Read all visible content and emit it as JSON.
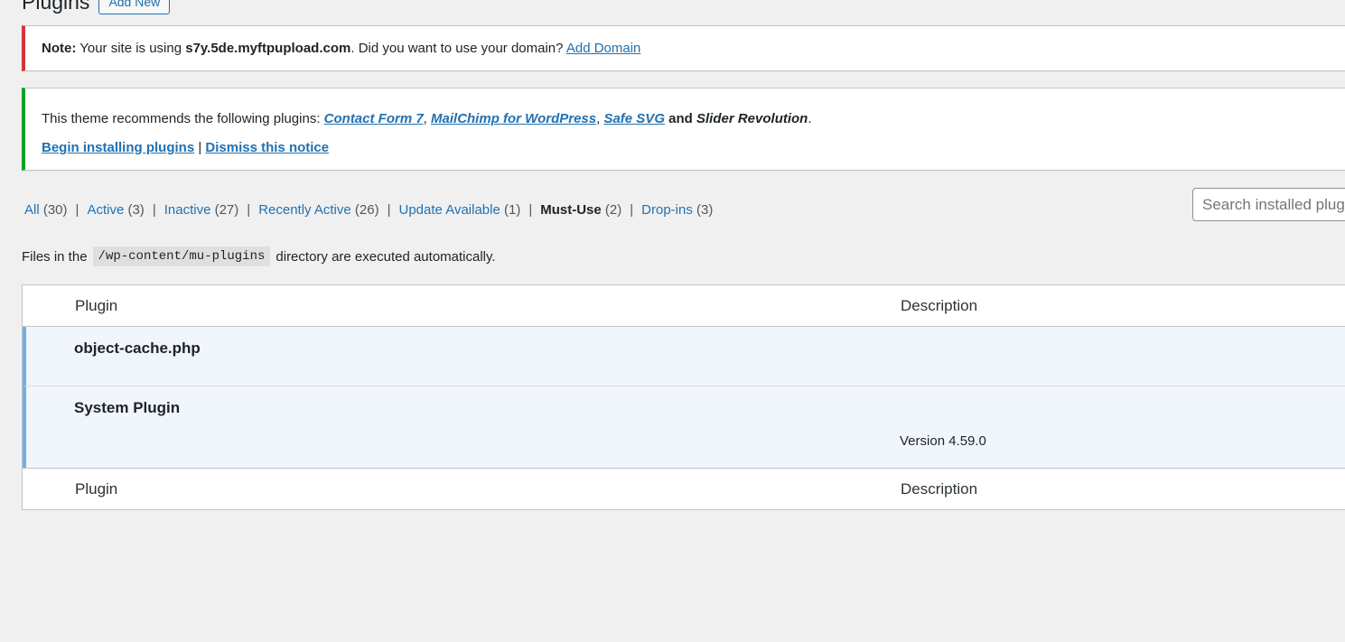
{
  "header": {
    "title": "Plugins",
    "add_new": "Add New"
  },
  "notice_domain": {
    "note_label": "Note:",
    "text_1": " Your site is using ",
    "domain": "s7y.5de.myftpupload.com",
    "text_2": ". Did you want to use your domain? ",
    "link": "Add Domain"
  },
  "notice_theme": {
    "intro": "This theme recommends the following plugins: ",
    "plugins": [
      "Contact Form 7",
      "MailChimp for WordPress",
      "Safe SVG",
      "Slider Revolution"
    ],
    "sep_comma": ", ",
    "sep_and": " and ",
    "end": ".",
    "begin_link": "Begin installing plugins",
    "divider": " | ",
    "dismiss_link": "Dismiss this notice"
  },
  "filters": [
    {
      "label": "All",
      "count": "(30)"
    },
    {
      "label": "Active",
      "count": "(3)"
    },
    {
      "label": "Inactive",
      "count": "(27)"
    },
    {
      "label": "Recently Active",
      "count": "(26)"
    },
    {
      "label": "Update Available",
      "count": "(1)"
    },
    {
      "label": "Must-Use",
      "count": "(2)",
      "current": true
    },
    {
      "label": "Drop-ins",
      "count": "(3)"
    }
  ],
  "search": {
    "placeholder": "Search installed plugins..."
  },
  "mu_note": {
    "before": "Files in the",
    "path": "/wp-content/mu-plugins",
    "after": "directory are executed automatically."
  },
  "table": {
    "col_plugin": "Plugin",
    "col_description": "Description",
    "rows": [
      {
        "name": "object-cache.php",
        "version": ""
      },
      {
        "name": "System Plugin",
        "version": "Version 4.59.0"
      }
    ]
  },
  "colors": {
    "link": "#2271b1",
    "error_border": "#d63638",
    "success_border": "#00a32a",
    "row_highlight": "#f0f6fc",
    "row_border": "#72aee6"
  }
}
